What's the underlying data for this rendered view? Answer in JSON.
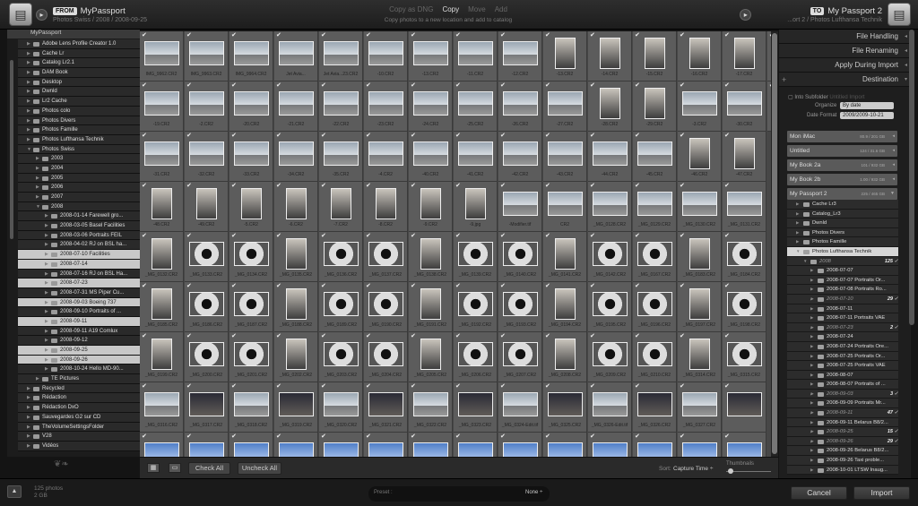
{
  "topbar": {
    "source": {
      "badge": "FROM",
      "name": "MyPassport",
      "path": "Photos Swiss / 2008 / 2008-09-25"
    },
    "modes": [
      "Copy as DNG",
      "Copy",
      "Move",
      "Add"
    ],
    "active_mode": "Copy",
    "mode_description": "Copy photos to a new location and add to catalog",
    "destination": {
      "badge": "TO",
      "name": "My Passport 2",
      "path": "...ort 2 / Photos Lufthansa Technik"
    }
  },
  "source_tree": {
    "root": "MyPassport",
    "items": [
      {
        "label": "Adobe Lens Profile Creator 1.0",
        "level": 0
      },
      {
        "label": "Cache Lr",
        "level": 0
      },
      {
        "label": "Catalog Lr2.1",
        "level": 0
      },
      {
        "label": "DAM Book",
        "level": 0
      },
      {
        "label": "Desktop",
        "level": 0
      },
      {
        "label": "Dwnld",
        "level": 0
      },
      {
        "label": "Lr2 Cache",
        "level": 0
      },
      {
        "label": "Photos colo",
        "level": 0
      },
      {
        "label": "Photos Divers",
        "level": 0
      },
      {
        "label": "Photos Famille",
        "level": 0
      },
      {
        "label": "Photos Lufthansa Technik",
        "level": 0
      },
      {
        "label": "Photos Swiss",
        "level": 0
      },
      {
        "label": "2003",
        "level": 1
      },
      {
        "label": "2004",
        "level": 1
      },
      {
        "label": "2005",
        "level": 1
      },
      {
        "label": "2006",
        "level": 1
      },
      {
        "label": "2007",
        "level": 1
      },
      {
        "label": "2008",
        "level": 1
      },
      {
        "label": "2008-01-14 Farewell gro...",
        "level": 2
      },
      {
        "label": "2008-03-05 Basel Facilities",
        "level": 2
      },
      {
        "label": "2008-03-06 Portraits FEIL",
        "level": 2
      },
      {
        "label": "2008-04-02 RJ on BSL ha...",
        "level": 2
      },
      {
        "label": "2008-07-10 Facilities",
        "level": 2,
        "selected": true
      },
      {
        "label": "2008-07-14",
        "level": 2,
        "selected": true
      },
      {
        "label": "2008-07-16 RJ on BSL Ha...",
        "level": 2
      },
      {
        "label": "2008-07-23",
        "level": 2,
        "selected": true
      },
      {
        "label": "2008-07-31 MS Piper Cu...",
        "level": 2
      },
      {
        "label": "2008-09-03 Boeing 737",
        "level": 2,
        "selected": true
      },
      {
        "label": "2008-09-10 Portraits of ...",
        "level": 2
      },
      {
        "label": "2008-09-11",
        "level": 2,
        "selected": true
      },
      {
        "label": "2008-09-11 A19 Comlux",
        "level": 2
      },
      {
        "label": "2008-09-12",
        "level": 2
      },
      {
        "label": "2008-09-25",
        "level": 2,
        "selected": true
      },
      {
        "label": "2008-09-26",
        "level": 2,
        "selected": true
      },
      {
        "label": "2008-10-24 Hello MD-90...",
        "level": 2
      },
      {
        "label": "TE Pictures",
        "level": 1
      },
      {
        "label": "Recycled",
        "level": 0
      },
      {
        "label": "Rédaction",
        "level": 0
      },
      {
        "label": "Rédaction DxO",
        "level": 0
      },
      {
        "label": "Sauvegardes G2 sur CD",
        "level": 0
      },
      {
        "label": "TheVolumeSettingsFolder",
        "level": 0
      },
      {
        "label": "V28",
        "level": 0
      },
      {
        "label": "Vidéos",
        "level": 0
      }
    ]
  },
  "grid": {
    "rows": [
      [
        "IMG_9962.CR2",
        "IMG_9963.CR2",
        "IMG_9964.CR2",
        "Jet Avia...",
        "Jet Avia...23.CR2",
        "-10.CR2",
        "-13.CR2",
        "-11.CR2",
        "-12.CR2",
        "-13.CR2",
        "-14.CR2",
        "-15.CR2",
        "-16.CR2",
        "-17.CR2",
        "-18.CR2"
      ],
      [
        "-19.CR2",
        "-2.CR2",
        "-20.CR2",
        "-21.CR2",
        "-22.CR2",
        "-23.CR2",
        "-24.CR2",
        "-25.CR2",
        "-26.CR2",
        "-27.CR2",
        "-28.CR2",
        "-29.CR2",
        "-3.CR2",
        "-30.CR2",
        "-31.CR2"
      ],
      [
        "-31.CR2",
        "-32.CR2",
        "-33.CR2",
        "-34.CR2",
        "-35.CR2",
        "-4.CR2",
        "-40.CR2",
        "-41.CR2",
        "-42.CR2",
        "-43.CR2",
        "-44.CR2",
        "-45.CR2",
        "-46.CR2",
        "-47.CR2",
        ""
      ],
      [
        "-48.CR2",
        "-49.CR2",
        "-5.CR2",
        "-6.CR2",
        "-7.CR2",
        "-8.CR2",
        "-9.CR2",
        "-9.jpg",
        "-Modifier.tif",
        "CR2",
        "_MG_0128.CR2",
        "_MG_0129.CR2",
        "_MG_0130.CR2",
        "_MG_0131.CR2",
        ""
      ],
      [
        "_MG_0132.CR2",
        "_MG_0133.CR2",
        "_MG_0134.CR2",
        "_MG_0135.CR2",
        "_MG_0136.CR2",
        "_MG_0137.CR2",
        "_MG_0138.CR2",
        "_MG_0139.CR2",
        "_MG_0140.CR2",
        "_MG_0141.CR2",
        "_MG_0142.CR2",
        "_MG_0167.CR2",
        "_MG_0183.CR2",
        "_MG_0184.CR2",
        ""
      ],
      [
        "_MG_0185.CR2",
        "_MG_0186.CR2",
        "_MG_0187.CR2",
        "_MG_0188.CR2",
        "_MG_0189.CR2",
        "_MG_0190.CR2",
        "_MG_0191.CR2",
        "_MG_0192.CR2",
        "_MG_0193.CR2",
        "_MG_0194.CR2",
        "_MG_0195.CR2",
        "_MG_0196.CR2",
        "_MG_0197.CR2",
        "_MG_0198.CR2",
        ""
      ],
      [
        "_MG_0199.CR2",
        "_MG_0200.CR2",
        "_MG_0201.CR2",
        "_MG_0202.CR2",
        "_MG_0203.CR2",
        "_MG_0204.CR2",
        "_MG_0205.CR2",
        "_MG_0206.CR2",
        "_MG_0207.CR2",
        "_MG_0208.CR2",
        "_MG_0209.CR2",
        "_MG_0210.CR2",
        "_MG_0314.CR2",
        "_MG_0315.CR2",
        ""
      ],
      [
        "_MG_0316.CR2",
        "_MG_0317.CR2",
        "_MG_0318.CR2",
        "_MG_0319.CR2",
        "_MG_0320.CR2",
        "_MG_0321.CR2",
        "_MG_0322.CR2",
        "_MG_0323.CR2",
        "_MG_0324-Edit.tif",
        "_MG_0325.CR2",
        "_MG_0326-Edit.tif",
        "_MG_0326.CR2",
        "_MG_0327.CR2",
        "",
        ""
      ],
      [
        "",
        "",
        "",
        "",
        "",
        "",
        "",
        "",
        "",
        "",
        "",
        "",
        "",
        "",
        ""
      ]
    ]
  },
  "grid_toolbar": {
    "check_all": "Check All",
    "uncheck_all": "Uncheck All",
    "sort_label": "Sort:",
    "sort_value": "Capture Time ÷",
    "thumbnails_label": "Thumbnails"
  },
  "right_panel": {
    "sections": [
      {
        "label": "File Handling"
      },
      {
        "label": "File Renaming"
      },
      {
        "label": "Apply During Import"
      },
      {
        "label": "Destination"
      }
    ],
    "into_subfolder": "Into Subfolder",
    "subfolder_hint": "Untitled Import",
    "organize_label": "Organize",
    "organize_value": "By date",
    "date_format_label": "Date Format",
    "date_format_value": "2009/2009-10-21",
    "volumes": [
      {
        "name": "Mon iMac",
        "size": "80.9 / 201 GB"
      },
      {
        "name": "Untitled",
        "size": "124 / 31.6 GB"
      },
      {
        "name": "My Book 2a",
        "size": "101 / 932 GB"
      },
      {
        "name": "My Book 2b",
        "size": "1.00 / 932 GB"
      },
      {
        "name": "My Passport 2",
        "size": "225 / 465 GB"
      }
    ],
    "tree": [
      {
        "label": "Cache Lr3",
        "level": 1
      },
      {
        "label": "Catalog_Lr3",
        "level": 1
      },
      {
        "label": "Dwnld",
        "level": 1
      },
      {
        "label": "Photos Divers",
        "level": 1
      },
      {
        "label": "Photos Famille",
        "level": 1
      },
      {
        "label": "Photos Lufthansa Technik",
        "level": 1,
        "highlight": true
      },
      {
        "label": "2008",
        "level": 2,
        "italic": true,
        "count": "125"
      },
      {
        "label": "2008-07-07",
        "level": 3
      },
      {
        "label": "2008-07-07 Portraits Or...",
        "level": 3
      },
      {
        "label": "2008-07-08 Portraits Ro...",
        "level": 3
      },
      {
        "label": "2008-07-10",
        "level": 3,
        "italic": true,
        "count": "29"
      },
      {
        "label": "2008-07-11",
        "level": 3
      },
      {
        "label": "2008-07-11 Portraits VAE",
        "level": 3
      },
      {
        "label": "2008-07-23",
        "level": 3,
        "italic": true,
        "count": "2"
      },
      {
        "label": "2008-07-24",
        "level": 3
      },
      {
        "label": "2008-07-24 Portraits Ore...",
        "level": 3
      },
      {
        "label": "2008-07-25 Portraits Or...",
        "level": 3
      },
      {
        "label": "2008-07-25 Portraits VAE",
        "level": 3
      },
      {
        "label": "2008-08-07",
        "level": 3
      },
      {
        "label": "2008-08-07 Portraits of ...",
        "level": 3
      },
      {
        "label": "2008-09-03",
        "level": 3,
        "italic": true,
        "count": "3"
      },
      {
        "label": "2008-09-09 Portraits Mr...",
        "level": 3
      },
      {
        "label": "2008-09-11",
        "level": 3,
        "italic": true,
        "count": "47"
      },
      {
        "label": "2008-09-11 Belarus B8/2...",
        "level": 3
      },
      {
        "label": "2008-09-25",
        "level": 3,
        "italic": true,
        "count": "15"
      },
      {
        "label": "2008-09-26",
        "level": 3,
        "italic": true,
        "count": "29"
      },
      {
        "label": "2008-09-26 Belarus B8/2...",
        "level": 3
      },
      {
        "label": "2008-09-26 Taxi proble...",
        "level": 3
      },
      {
        "label": "2008-10-01 LTSW Inaug...",
        "level": 3
      }
    ]
  },
  "bottombar": {
    "photo_count": "125 photos",
    "size": "2 GB",
    "preset_label": "Preset :",
    "preset_value": "None ÷",
    "cancel": "Cancel",
    "import": "Import"
  }
}
